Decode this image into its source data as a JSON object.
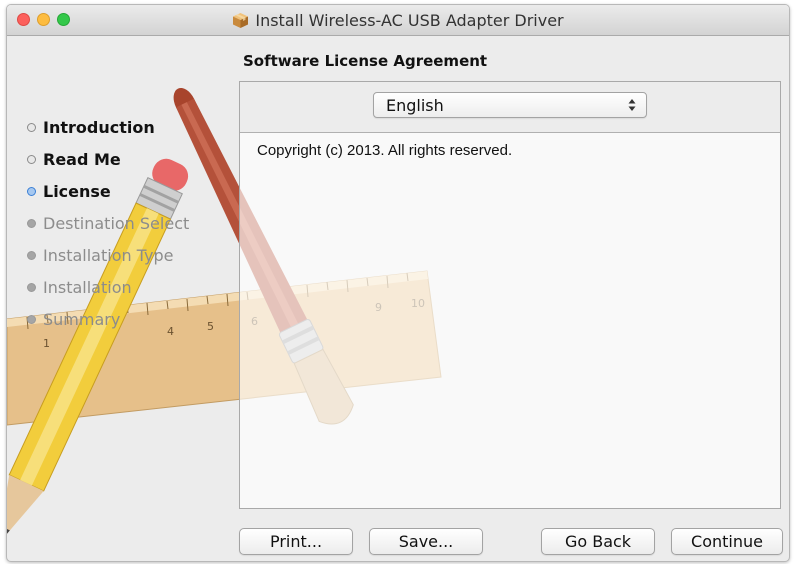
{
  "window": {
    "title": "Install Wireless-AC USB Adapter Driver",
    "app_icon": "package-icon"
  },
  "header": {
    "title": "Software License Agreement"
  },
  "steps": [
    {
      "label": "Introduction",
      "state": "completed"
    },
    {
      "label": "Read Me",
      "state": "completed"
    },
    {
      "label": "License",
      "state": "current"
    },
    {
      "label": "Destination Select",
      "state": "pending"
    },
    {
      "label": "Installation Type",
      "state": "pending"
    },
    {
      "label": "Installation",
      "state": "pending"
    },
    {
      "label": "Summary",
      "state": "pending"
    }
  ],
  "language": {
    "selected": "English"
  },
  "license": {
    "text": "Copyright (c) 2013.  All rights reserved."
  },
  "buttons": {
    "print": "Print...",
    "save": "Save...",
    "go_back": "Go Back",
    "continue": "Continue"
  },
  "ruler": {
    "numbers": [
      "1",
      "4",
      "5",
      "6",
      "9",
      "10"
    ]
  },
  "colors": {
    "current_step": "#3a7fd5",
    "close": "#fc605c",
    "minimize": "#fdbc40",
    "zoom": "#34c84a"
  }
}
